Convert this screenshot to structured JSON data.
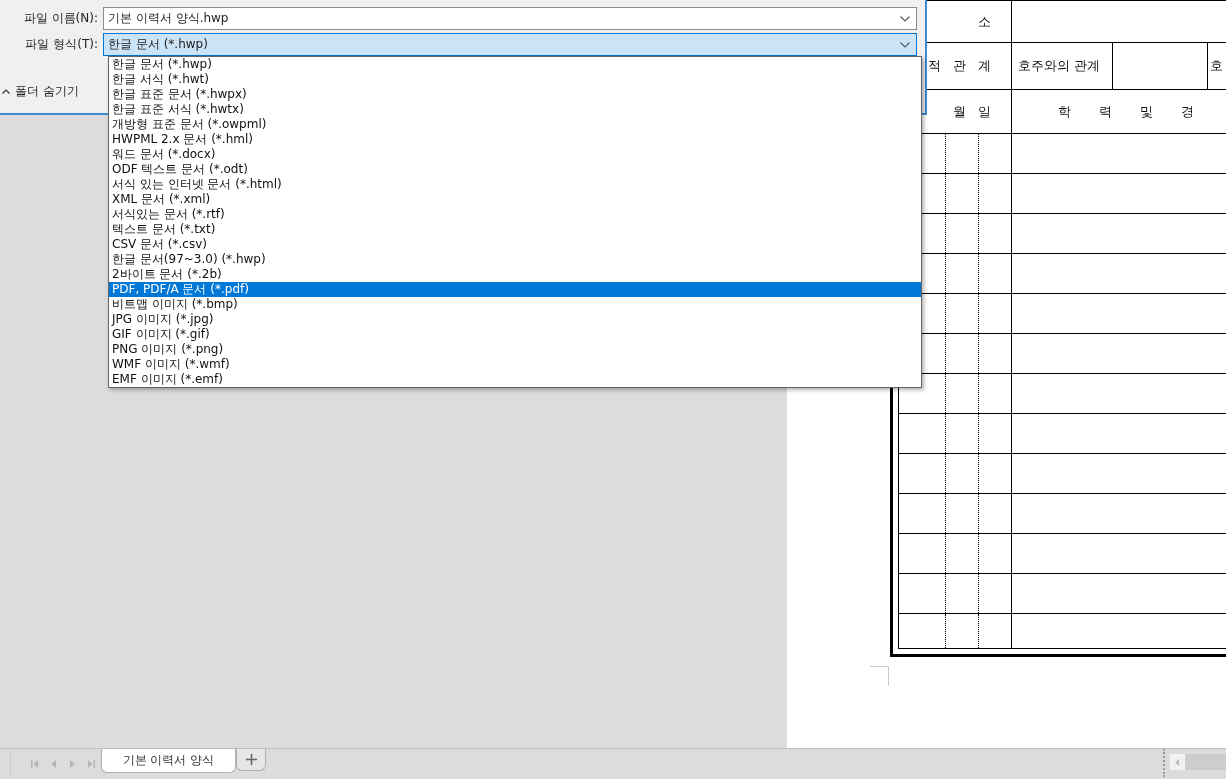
{
  "dialog": {
    "file_name_label": "파일 이름(N):",
    "file_name_value": "기본 이력서 양식.hwp",
    "file_type_label": "파일 형식(T):",
    "file_type_value": "한글 문서 (*.hwp)",
    "hide_folders_label": "폴더 숨기기",
    "file_types": [
      {
        "label": "한글 문서 (*.hwp)",
        "selected": false
      },
      {
        "label": "한글 서식 (*.hwt)",
        "selected": false
      },
      {
        "label": "한글 표준 문서 (*.hwpx)",
        "selected": false
      },
      {
        "label": "한글 표준 서식 (*.hwtx)",
        "selected": false
      },
      {
        "label": "개방형 표준 문서 (*.owpml)",
        "selected": false
      },
      {
        "label": "HWPML 2.x 문서 (*.hml)",
        "selected": false
      },
      {
        "label": "워드 문서 (*.docx)",
        "selected": false
      },
      {
        "label": "ODF 텍스트 문서 (*.odt)",
        "selected": false
      },
      {
        "label": "서식 있는 인터넷 문서 (*.html)",
        "selected": false
      },
      {
        "label": "XML 문서 (*.xml)",
        "selected": false
      },
      {
        "label": "서식있는 문서 (*.rtf)",
        "selected": false
      },
      {
        "label": "텍스트 문서 (*.txt)",
        "selected": false
      },
      {
        "label": "CSV 문서 (*.csv)",
        "selected": false
      },
      {
        "label": "한글 문서(97~3.0) (*.hwp)",
        "selected": false
      },
      {
        "label": "2바이트 문서 (*.2b)",
        "selected": false
      },
      {
        "label": "PDF, PDF/A 문서 (*.pdf)",
        "selected": true
      },
      {
        "label": "비트맵 이미지 (*.bmp)",
        "selected": false
      },
      {
        "label": "JPG 이미지 (*.jpg)",
        "selected": false
      },
      {
        "label": "GIF 이미지 (*.gif)",
        "selected": false
      },
      {
        "label": "PNG 이미지 (*.png)",
        "selected": false
      },
      {
        "label": "WMF 이미지 (*.wmf)",
        "selected": false
      },
      {
        "label": "EMF 이미지 (*.emf)",
        "selected": false
      }
    ]
  },
  "document": {
    "address_label": "소",
    "relation_label": "적 관 계",
    "head_relation_label": "호주와의 관계",
    "cut_label": "호",
    "date_label": "월 일",
    "history_label": "학 력 및 경"
  },
  "sheet_tabs": [
    {
      "label": "기본 이력서 양식",
      "selected": true
    }
  ]
}
